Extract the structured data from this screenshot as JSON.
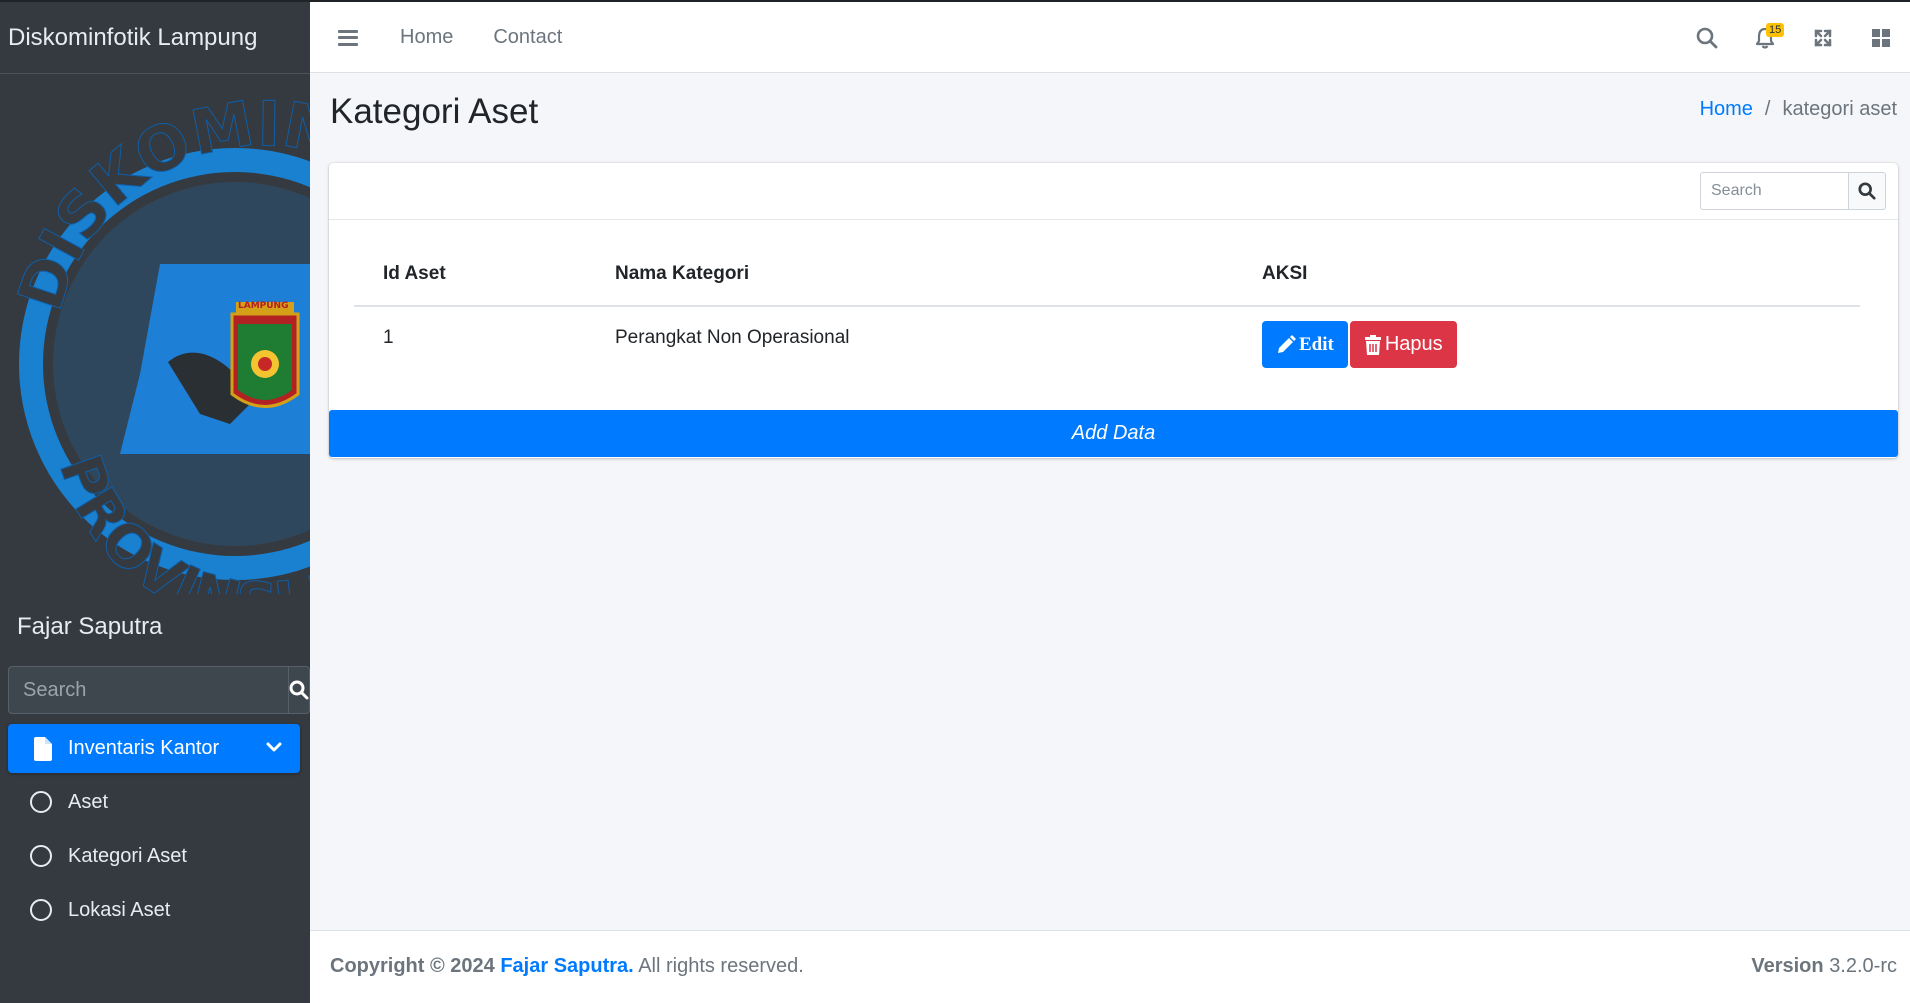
{
  "sidebar": {
    "brand": "Diskominfotik Lampung",
    "user_name": "Fajar Saputra",
    "search_placeholder": "Search",
    "menu_main": "Inventaris Kantor",
    "menu_items": [
      "Aset",
      "Kategori Aset",
      "Lokasi Aset"
    ],
    "logo_text_top": "DISKOMIN",
    "logo_text_bottom": "PROVINSI LA",
    "logo_shield_text": "LAMPUNG"
  },
  "navbar": {
    "links": [
      "Home",
      "Contact"
    ],
    "notification_count": "15",
    "icons": [
      "menu-icon",
      "search-icon",
      "bell-icon",
      "fullscreen-icon",
      "grid-icon"
    ]
  },
  "header": {
    "title": "Kategori Aset",
    "breadcrumb_home": "Home",
    "breadcrumb_separator": "/",
    "breadcrumb_current": "kategori aset"
  },
  "card": {
    "search_placeholder": "Search",
    "columns": [
      "Id Aset",
      "Nama Kategori",
      "AKSI"
    ],
    "rows": [
      {
        "id": "1",
        "nama": "Perangkat Non Operasional"
      }
    ],
    "edit_label": "Edit",
    "delete_label": "Hapus",
    "add_label": "Add Data"
  },
  "footer": {
    "copyright": "Copyright © 2024",
    "author": "Fajar Saputra.",
    "rights": "All rights reserved.",
    "version_label": "Version",
    "version_value": "3.2.0-rc"
  },
  "colors": {
    "primary": "#007bff",
    "danger": "#dc3545",
    "sidebar": "#343a40",
    "badge": "#ffc107"
  }
}
